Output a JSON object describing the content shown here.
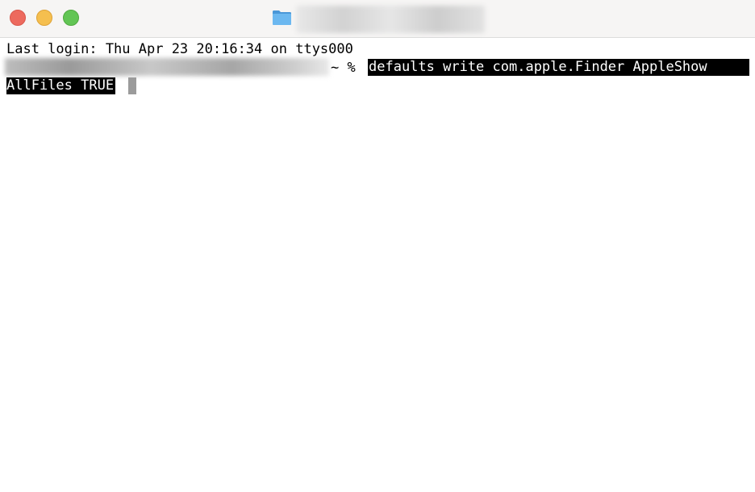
{
  "window": {
    "title_obscured": true,
    "icon": "folder-icon",
    "colors": {
      "close": "#ed6a5e",
      "minimize": "#f5bf4f",
      "zoom": "#62c554",
      "folder": "#5aa9e6",
      "selection": "#000000",
      "cursor": "#9b9b9b"
    }
  },
  "terminal": {
    "last_login": "Last login: Thu Apr 23 20:16:34 on ttys000",
    "prompt_suffix": "~ %",
    "command_line1": "defaults write com.apple.Finder AppleShow",
    "command_line2": "AllFiles TRUE"
  }
}
